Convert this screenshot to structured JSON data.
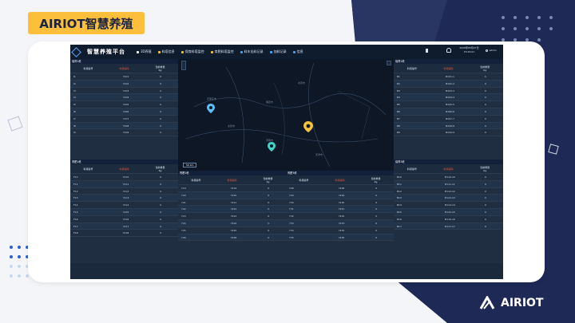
{
  "slide": {
    "title_tag": "AIRIOT智慧养殖",
    "brand": "AIRIOT"
  },
  "app": {
    "platform_title": "智慧养殖平台",
    "nav": [
      {
        "label": "3D养殖",
        "icon": "home-icon"
      },
      {
        "label": "料塔信息",
        "icon": "silo-icon"
      },
      {
        "label": "保育料塔监控",
        "icon": "monitor-icon"
      },
      {
        "label": "育肥料塔监控",
        "icon": "monitor-icon"
      },
      {
        "label": "料车出料记录",
        "icon": "truck-icon"
      },
      {
        "label": "加料记录",
        "icon": "record-icon"
      },
      {
        "label": "信息",
        "icon": "info-icon"
      }
    ],
    "datetime": {
      "date": "2020年05月27日",
      "time": "15:25:01"
    },
    "user": "admin"
  },
  "columns": {
    "code": "料塔编号",
    "id": "料塔编码",
    "weight": "当前重量",
    "unit": "Kg"
  },
  "panels": {
    "top_left": {
      "title": "保育1栋",
      "rows": [
        [
          "I1",
          "Y101",
          "0"
        ],
        [
          "I2",
          "Y102",
          "0"
        ],
        [
          "I3",
          "Y103",
          "0"
        ],
        [
          "I4",
          "Y104",
          "0"
        ],
        [
          "I5",
          "Y105",
          "0"
        ],
        [
          "I6",
          "Y106",
          "0"
        ],
        [
          "I7",
          "Y107",
          "0"
        ],
        [
          "I8",
          "Y108",
          "0"
        ],
        [
          "I9",
          "Y109",
          "0"
        ]
      ]
    },
    "bottom_left": {
      "title": "育肥1栋",
      "rows": [
        [
          "F10",
          "Y210",
          "0"
        ],
        [
          "F11",
          "Y211",
          "0"
        ],
        [
          "F12",
          "Y212",
          "0"
        ],
        [
          "F13",
          "Y213",
          "0"
        ],
        [
          "F14",
          "Y214",
          "0"
        ],
        [
          "F15",
          "Y215",
          "0"
        ],
        [
          "F16",
          "Y216",
          "0"
        ],
        [
          "F17",
          "Y217",
          "0"
        ],
        [
          "F18",
          "Y218",
          "0"
        ]
      ]
    },
    "bottom_mid1": {
      "title": "育肥2栋",
      "rows": [
        [
          "Y19",
          "Y219",
          "0"
        ],
        [
          "Y20",
          "Y220",
          "0"
        ],
        [
          "Y21",
          "Y221",
          "0"
        ],
        [
          "Y22",
          "Y222",
          "0"
        ],
        [
          "Y23",
          "Y223",
          "0"
        ],
        [
          "Y24",
          "Y224",
          "0"
        ],
        [
          "Y25",
          "Y225",
          "0"
        ],
        [
          "Y26",
          "Y226",
          "0"
        ]
      ]
    },
    "bottom_mid2": {
      "title": "育肥3栋",
      "rows": [
        [
          "Y28",
          "Y228",
          "0"
        ],
        [
          "Y29",
          "Y229",
          "0"
        ],
        [
          "Y30",
          "Y230",
          "0"
        ],
        [
          "Y31",
          "Y231",
          "0"
        ],
        [
          "Y32",
          "Y232",
          "0"
        ],
        [
          "Y33",
          "Y233",
          "0"
        ],
        [
          "Y34",
          "Y234",
          "0"
        ],
        [
          "Y35",
          "Y235",
          "0"
        ]
      ]
    },
    "top_right": {
      "title": "保育2栋",
      "rows": [
        [
          "B1",
          "B101-1",
          "0"
        ],
        [
          "B2",
          "B102-2",
          "0"
        ],
        [
          "B3",
          "B103-3",
          "0"
        ],
        [
          "B4",
          "B104-4",
          "0"
        ],
        [
          "B5",
          "B105-5",
          "0"
        ],
        [
          "B6",
          "B106-6",
          "0"
        ],
        [
          "B7",
          "B107-7",
          "0"
        ],
        [
          "B8",
          "B108-8",
          "0"
        ],
        [
          "B9",
          "B109-9",
          "0"
        ]
      ]
    },
    "bottom_right": {
      "title": "保育3栋",
      "rows": [
        [
          "B10",
          "B110-10",
          "0"
        ],
        [
          "B11",
          "B111-11",
          "0"
        ],
        [
          "B12",
          "B112-12",
          "0"
        ],
        [
          "B13",
          "B113-13",
          "0"
        ],
        [
          "B14",
          "B114-14",
          "0"
        ],
        [
          "B15",
          "B115-15",
          "0"
        ],
        [
          "B16",
          "B116-16",
          "0"
        ],
        [
          "B17",
          "B117-17",
          "0"
        ]
      ]
    }
  },
  "map": {
    "labels": [
      "石家庄市",
      "邯郸市",
      "太原市",
      "天津市",
      "济南市",
      "郑州市",
      "保定市",
      "北京市"
    ],
    "scale": "50 km",
    "marker_colors": [
      "#5bc0f8",
      "#f5c33b",
      "#3fd4c8"
    ]
  }
}
